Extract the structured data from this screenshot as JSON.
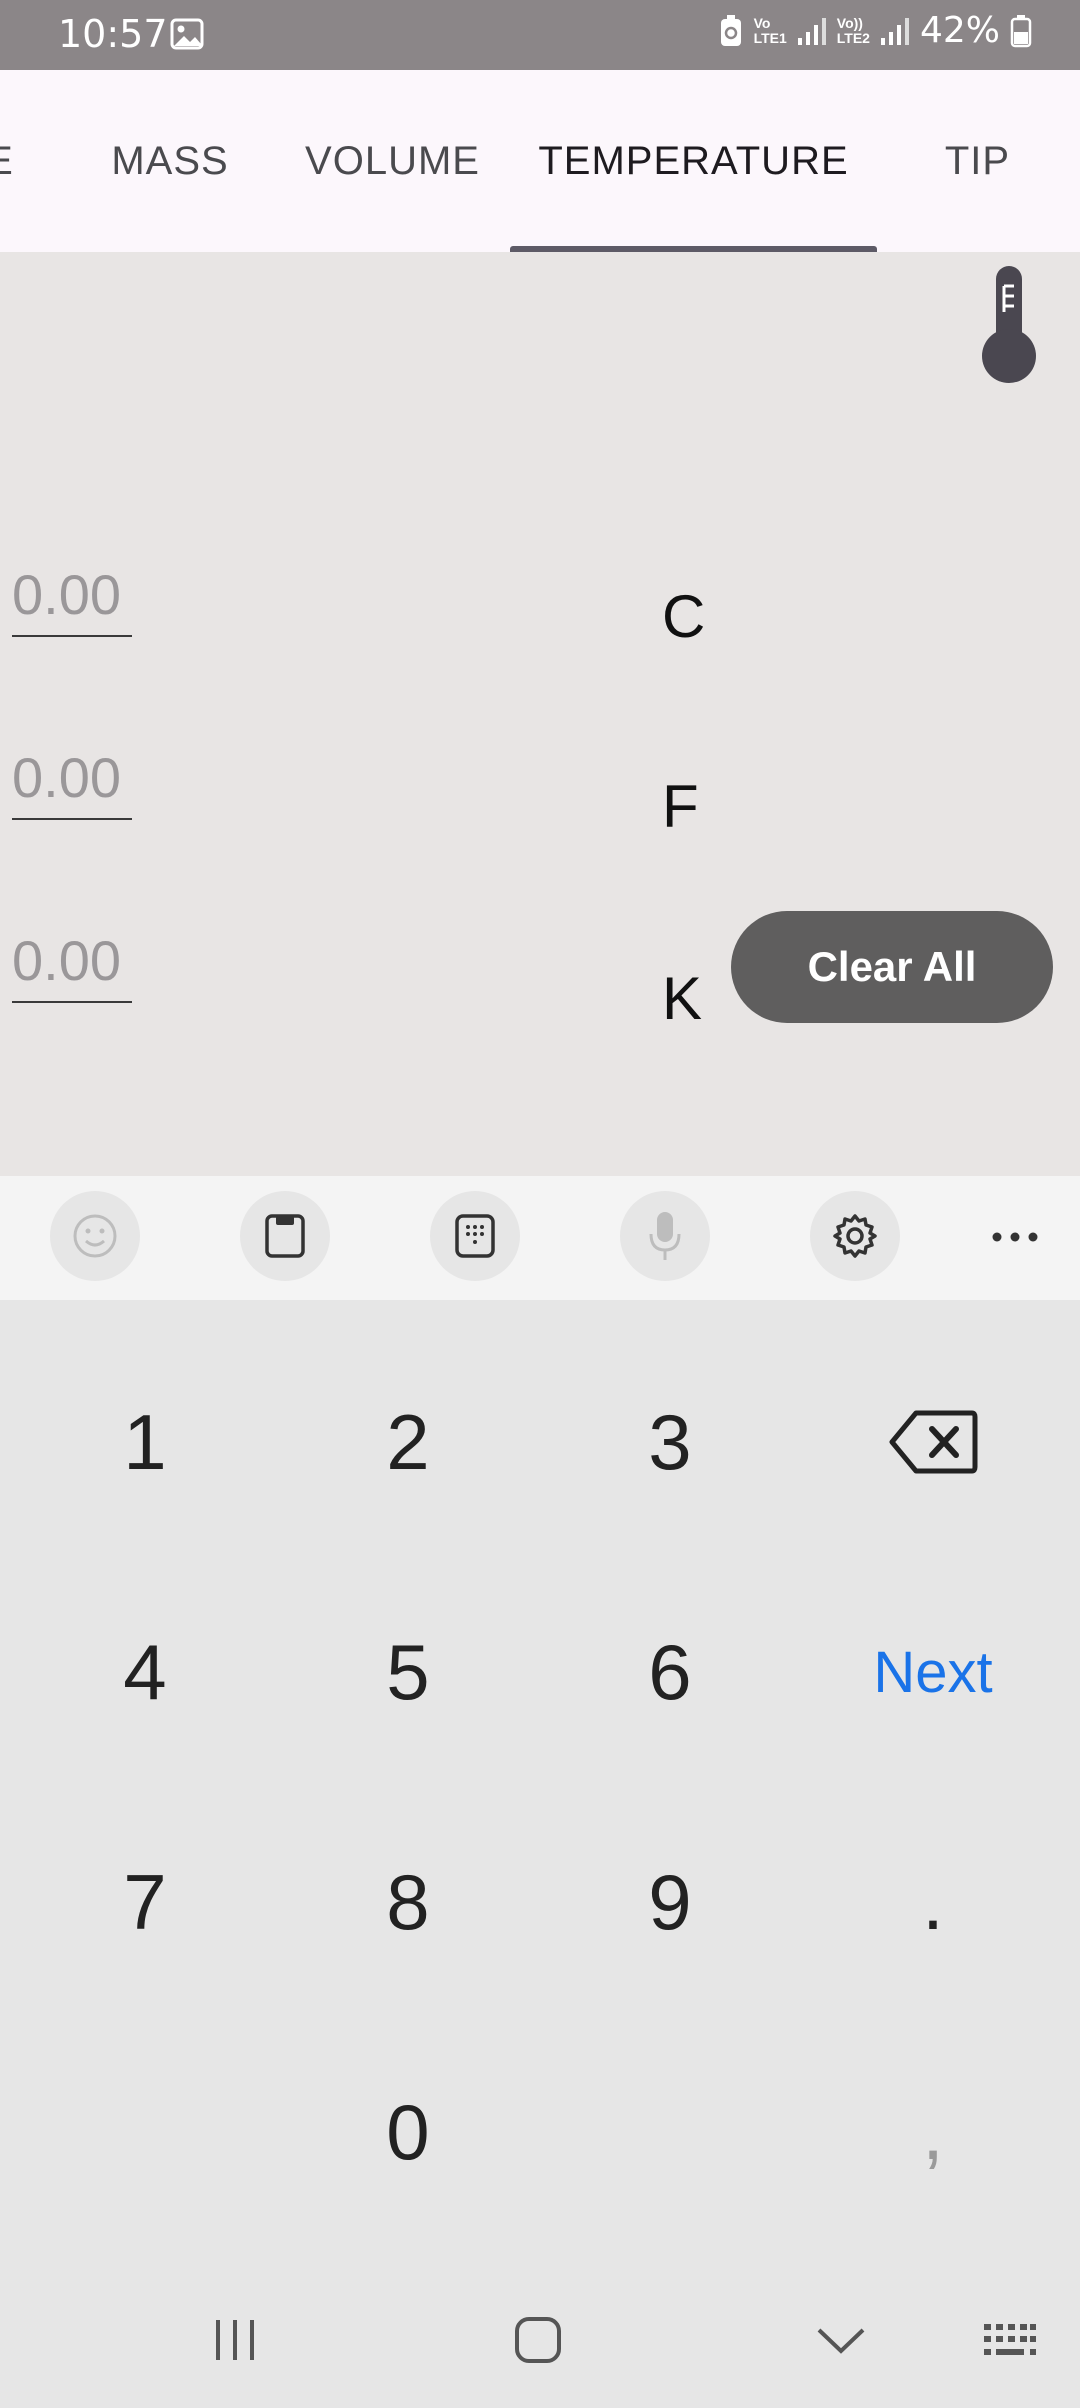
{
  "status": {
    "time": "10:57",
    "network1": [
      "Vo",
      "LTE1"
    ],
    "network2": [
      "Vo))",
      "LTE2"
    ],
    "battery": "42%"
  },
  "tabs": [
    {
      "label": "E",
      "active": false
    },
    {
      "label": "MASS",
      "active": false
    },
    {
      "label": "VOLUME",
      "active": false
    },
    {
      "label": "TEMPERATURE",
      "active": true
    },
    {
      "label": "TIP",
      "active": false
    }
  ],
  "converter": {
    "rows": [
      {
        "placeholder": "0.00",
        "unit": "C"
      },
      {
        "placeholder": "0.00",
        "unit": "F"
      },
      {
        "placeholder": "0.00",
        "unit": "K"
      }
    ],
    "clear_label": "Clear All"
  },
  "keyboard": {
    "toolbar_icons": [
      "emoji-icon",
      "clipboard-icon",
      "numpad-icon",
      "microphone-icon",
      "settings-icon",
      "more-icon"
    ],
    "keys": {
      "k1": "1",
      "k2": "2",
      "k3": "3",
      "k4": "4",
      "k5": "5",
      "k6": "6",
      "next": "Next",
      "k7": "7",
      "k8": "8",
      "k9": "9",
      "dot": ".",
      "k0": "0",
      "comma": ","
    }
  },
  "colors": {
    "status_bar": "#8b8688",
    "tab_bar": "#fcf7fc",
    "content": "#e8e5e4",
    "clear_button": "#5f5e5e",
    "next_key": "#1a73e8"
  }
}
